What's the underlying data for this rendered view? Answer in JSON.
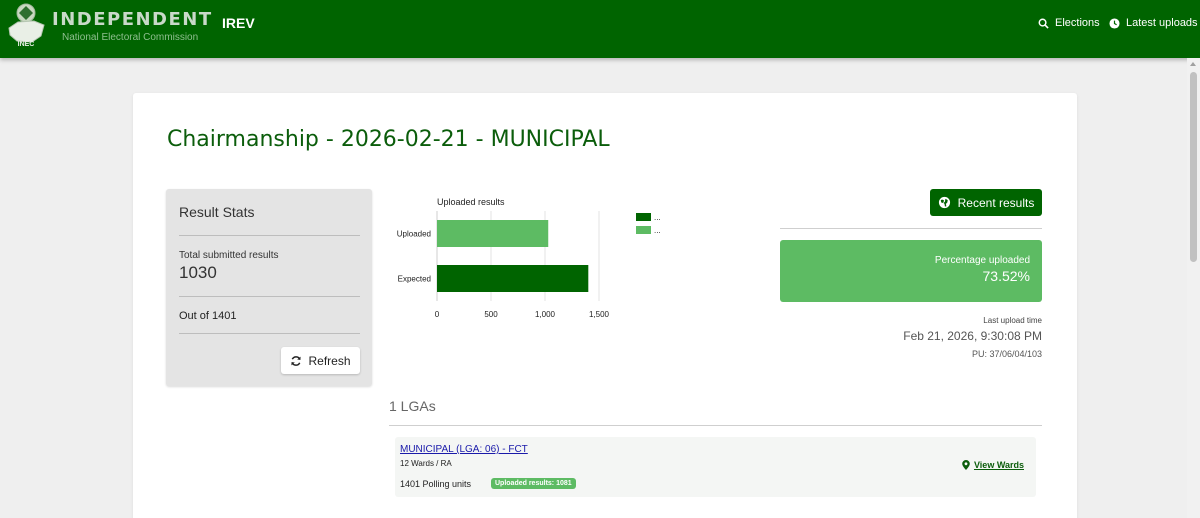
{
  "header": {
    "brand_name": "INDEPENDENT",
    "brand_sub": "National Electoral Commission",
    "logo_text": "INEC",
    "app_name": "IREV",
    "nav": [
      {
        "label": "Elections",
        "icon": "search-icon"
      },
      {
        "label": "Latest uploads",
        "icon": "clock-icon"
      }
    ]
  },
  "page": {
    "title": "Chairmanship - 2026-02-21 - MUNICIPAL"
  },
  "stats": {
    "title": "Result Stats",
    "total_label": "Total submitted results",
    "total_value": "1030",
    "out_of": "Out of 1401",
    "refresh_label": "Refresh",
    "refresh_icon": "refresh-icon"
  },
  "chart_data": {
    "type": "bar",
    "orientation": "horizontal",
    "title": "Uploaded results",
    "categories": [
      "Uploaded",
      "Expected"
    ],
    "values": [
      1030,
      1401
    ],
    "colors": [
      "#5dbb63",
      "#006400"
    ],
    "xlim": [
      0,
      1500
    ],
    "xticks": [
      0,
      500,
      1000,
      1500
    ],
    "xtick_labels": [
      "0",
      "500",
      "1,000",
      "1,500"
    ],
    "legend": {
      "placement": "right",
      "entries": [
        "...",
        "..."
      ],
      "colors": [
        "#006400",
        "#5dbb63"
      ]
    },
    "grid": "vertical"
  },
  "recent": {
    "button_label": "Recent results",
    "icon": "globe-icon",
    "percentage_label": "Percentage uploaded",
    "percentage_value": "73.52%",
    "last_upload_label": "Last upload time",
    "last_upload_time": "Feb 21, 2026, 9:30:08 PM",
    "pu_code": "PU: 37/06/04/103"
  },
  "lgas": {
    "count_label": "1 LGAs",
    "items": [
      {
        "name": "MUNICIPAL (LGA: 06) - FCT",
        "wards": "12 Wards / RA",
        "polling_units": "1401 Polling units",
        "badge": "Uploaded results: 1081",
        "action": "View Wards"
      }
    ]
  },
  "colors": {
    "primary": "#006400",
    "accent": "#5dbb63",
    "link": "#1a1aaa"
  }
}
